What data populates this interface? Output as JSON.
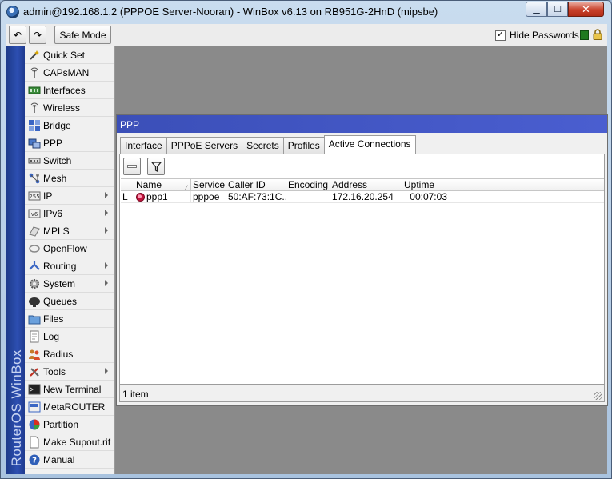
{
  "window": {
    "title": "admin@192.168.1.2 (PPPOE Server-Nooran) - WinBox v6.13 on RB951G-2HnD (mipsbe)",
    "min_glyph": "▁",
    "max_glyph": "☐",
    "close_glyph": "✕"
  },
  "toolbar": {
    "undo_glyph": "↶",
    "redo_glyph": "↷",
    "safe_mode_label": "Safe Mode",
    "hide_passwords_label": "Hide Passwords",
    "hide_passwords_checked": "✓",
    "status_color": "#1f7a1f"
  },
  "brand": "RouterOS WinBox",
  "sidebar": {
    "items": [
      {
        "label": "Quick Set",
        "icon": "wand-icon",
        "submenu": false
      },
      {
        "label": "CAPsMAN",
        "icon": "antenna-icon",
        "submenu": false
      },
      {
        "label": "Interfaces",
        "icon": "interfaces-icon",
        "submenu": false
      },
      {
        "label": "Wireless",
        "icon": "antenna-icon",
        "submenu": false
      },
      {
        "label": "Bridge",
        "icon": "bridge-icon",
        "submenu": false
      },
      {
        "label": "PPP",
        "icon": "ppp-icon",
        "submenu": false
      },
      {
        "label": "Switch",
        "icon": "switch-icon",
        "submenu": false
      },
      {
        "label": "Mesh",
        "icon": "mesh-icon",
        "submenu": false
      },
      {
        "label": "IP",
        "icon": "ip-icon",
        "submenu": true
      },
      {
        "label": "IPv6",
        "icon": "ipv6-icon",
        "submenu": true
      },
      {
        "label": "MPLS",
        "icon": "mpls-icon",
        "submenu": true
      },
      {
        "label": "OpenFlow",
        "icon": "openflow-icon",
        "submenu": false
      },
      {
        "label": "Routing",
        "icon": "routing-icon",
        "submenu": true
      },
      {
        "label": "System",
        "icon": "gear-icon",
        "submenu": true
      },
      {
        "label": "Queues",
        "icon": "queues-icon",
        "submenu": false
      },
      {
        "label": "Files",
        "icon": "folder-icon",
        "submenu": false
      },
      {
        "label": "Log",
        "icon": "log-icon",
        "submenu": false
      },
      {
        "label": "Radius",
        "icon": "users-icon",
        "submenu": false
      },
      {
        "label": "Tools",
        "icon": "tools-icon",
        "submenu": true
      },
      {
        "label": "New Terminal",
        "icon": "terminal-icon",
        "submenu": false
      },
      {
        "label": "MetaROUTER",
        "icon": "metarouter-icon",
        "submenu": false
      },
      {
        "label": "Partition",
        "icon": "partition-icon",
        "submenu": false
      },
      {
        "label": "Make Supout.rif",
        "icon": "document-icon",
        "submenu": false
      },
      {
        "label": "Manual",
        "icon": "help-icon",
        "submenu": false
      }
    ]
  },
  "ppp": {
    "title": "PPP",
    "tabs": [
      {
        "label": "Interface",
        "active": false
      },
      {
        "label": "PPPoE Servers",
        "active": false
      },
      {
        "label": "Secrets",
        "active": false
      },
      {
        "label": "Profiles",
        "active": false
      },
      {
        "label": "Active Connections",
        "active": true
      }
    ],
    "columns": [
      "",
      "Name",
      "Service",
      "Caller ID",
      "Encoding",
      "Address",
      "Uptime",
      ""
    ],
    "rows": [
      {
        "flag": "L",
        "name": "ppp1",
        "service": "pppoe",
        "caller_id": "50:AF:73:1C...",
        "encoding": "",
        "address": "172.16.20.254",
        "uptime": "00:07:03"
      }
    ],
    "status": "1 item"
  }
}
